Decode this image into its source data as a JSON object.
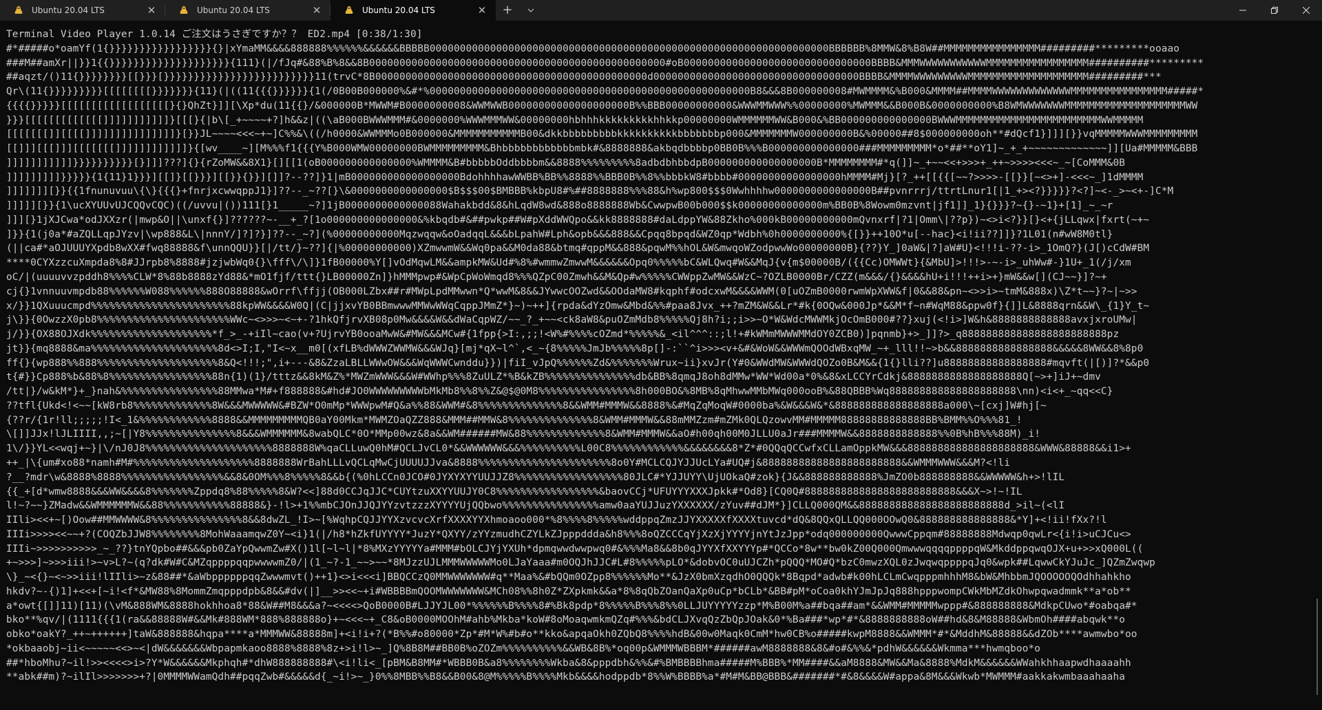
{
  "titlebar": {
    "tabs": [
      {
        "label": "Ubuntu 20.04 LTS",
        "active": false
      },
      {
        "label": "Ubuntu 20.04 LTS",
        "active": false
      },
      {
        "label": "Ubuntu 20.04 LTS",
        "active": true
      }
    ],
    "close_glyph": "✕",
    "new_tab_glyph": "+",
    "dropdown_glyph": "⌄",
    "window_controls": {
      "minimize": "—",
      "restore": "❐",
      "close": "✕"
    }
  },
  "colors": {
    "terminal_bg": "#0c0c0c",
    "terminal_fg": "#cccccc",
    "titlebar_bg": "#202020",
    "ubuntu_icon": "#e95420"
  },
  "icons": {
    "tab_icon": "penguin-icon"
  },
  "terminal": {
    "lines": [
      "Terminal Video Player 1.0.14 ご注文はうさぎですか？？ ED2.mp4 [0:38/1:30]",
      "#*#####o*oamYf(1{}}}}}}}}}}}}}}}}}{}|xYmaMM&&&&888888%%%%%%&&&&&&BBBBB000000000000000000000000000000000000000000000000000000000000000000BBBBBB%8MMW&8%B8W##MMMMMMMMMMMMMMMM#########*********ooaao",
      "###M##amXr||}}1{{}}}}}}}}}}}}}}}}}}}}{111}(|/fJq#&88%B%8&&8B0000000000000000000000000000000000000000000000000#oB0000000000000000000000000000000BBBB&MMMWWWWWWWWWWWMMMMMMMMMMMMMMMMM##########*********",
      "##aqzt/()11{}}}}}}}}[[}}}[}}}}}}}}}}}}}}}}}}}}}}}}}11(trvC*8B000000000000000000000000000000000000000000000d0000000000000000000000000000000000BBBB&MMMMWWWWWWWWWMMMMMMMMMMMMMMMMMMMM#########***",
      "Qr\\(11{}}}}}}}}}[[[[[[[[}}}}}}}{11}(|((11{{{}}}}}}{1(/0B00B000000%&#*%00000000000000000000000000000000000000000000000000000B8&&&8B000000008#MWMMMM&%B000&MMMM##MMMMWWWWWWWWWWWWWMMMMMMMMMMMMMMMM#####*",
      "{{{{}}}}}[[[[[[[[[[[[[[[[[[}{}QhZt}]][\\Xp*du(11{{}/&000000B*MWWM#B0000000008&WWMWWB00000000000000000000B%%BBB00000000000&WWWMMWWW%%00000000%MWMMM&&B000B&0000000000%B8WMWWWWWWWMMMMMMMMMMMMMMMMMMMMWW",
      "}}}[[[[[[[[[[[[[]]]]]]]]]]]}[[[}{|b\\[_+~~~~+?]h&&z|((\\aB000BWWWMMM#&0000000%WWWMMMWW&00000000hbhhhkkkkkkkkkhhkkp00000000WMMMMMMWW&B000&%BB000000000000000BWWWMMMMMMMMMMMMMMMMMMMMMMMMWWMMMMM",
      "[[[[[[[]][[[[]]]]]]]]]]]]]]]}[}}JL~~~~<<<~+~]C%%&\\((/h0000&WWMMMo0B000000&MMMMMMMMMMMB00&dkkbbbbbbbbbkkkkkkkkkkbbbbbbbp000&MMMMMMMW000000000B&%00000##8$000000000oh**#dQcf1}]]][}}vqMMMMMWWWMMMMMMMMM",
      "[[]]][[[]]][[[[[[[]]]]]]]]]]]]}{[wv____~][M%%%f1{{{Y%B000WMW00000000BWMMMMMMMMM&Bhbbbbbbbbbbbbmbk#&8888888&akbqdbbbbp0BB0B%%%B000000000000000###MMMMMMMMM*o*##**oY1]~_+_+~~~~~~~~~~~~~]][Ua#MMMMM&BBB",
      "]]]]]]]]]]]}}}}}}}}}}[}]]]???]{}{rZoMW&&8X1}[][[1(oB000000000000000%WMMMM&B#bbbbbOddbbbbm&&8888%%%%%%%%%8adbdbhbbdpB000000000000000000B*MMMMMMMM#*q(]]~_+~~<<+>>>+_++~>>>><<<~_~[CoMMM&0B",
      "]]]]]]]]]}}}}}{1{11}1}}}][[]}[[}}}][[}}{}}][]]?--??]}1|mB000000000000000000BdohhhhawWWBB%BB%%8888%%BBB0B%%8%%bbbkW8#bbbb#00000000000000000hMMMM#Mj}[?_++[[{{[~~?>>>>-[[}}[~<>+]-<<<~_]1dMMMM",
      "]]]]]]][}}{{1fnunuvuu\\{\\}{{{}+fnrjxcwwqppJ1}]??--_~??[}\\&0000000000000000$B$$$00$BMBBB%kbpU8#%##8888888%%%88&h%wp800$$$0Wwhhhhw0000000000000000B##pvnrrrj/ttrtLnur1[|1_+><?}}}}}?<?]~<-_>~<+-]C*M",
      "]]]]][}}{1\\ucXYUUvUJCQQvCQC)((/uvvu|())111[}1_____~?]1jB0000000000000088Wahakbdd&8&hLqdW8wd&888o8888888Wb&CwwpwB00b000$$k00000000000000m%BB0B%8Wowm0mzvnt|jf1]]_1}{}}}?~{}-~1}+[1]_~_~r",
      "]]][}1jXJCwa*odJXXzr(|mwp&O||\\unxf{}]??????~-__+_?[1o000000000000000&%kbqdb#&##pwkp##W#pXddWWQpo&&kk8888888#daLdppYW&88Zkho%000kB00000000000mQvnxrf|?1|Omm\\|??p})~<>i<?}}[}<+{jLLqwx|fxrt(~+~",
      "]}}{1(j0a*#aZQLLqpJYzv|\\wp888&L\\|nnnY/]?]?}]??--_~?](%00000000000Mqzwqqw&oOadqqL&&&bLpahW#Lph&opb&&&888&&Cpqq8bpqd&WZ0qp*Wdbh%0h0000000000%{[}}++10O*u[--hac}<i!ii??]]}?1L01(n#wW8M0tl}",
      "(||ca#*aOJUUUYXpdb8wXX#fwq88888&f\\unnQQU}}[|/tt/}~??]{|%00000000000)XZmwwmW&&Wq0pa&&M0da88&btmq#qppM&&888&pqwM%%hOL&W&mwqoWZodpwwWo00000000B}{??}Y_]0aW&|?]aW#U}<!!!i-??-i>_1OmQ?}(J[)cCdW#BM",
      "****0CYXzzcuXmpda8%8#JJrpb8%8888#jzjwbWq0{}\\fff\\/\\]}1fB00000%Y[]vOdMqwLM&&ampkMW&Ud#%8%#wmmwZmwwM&&&&&&Opq0%%%%%bC&WLQwq#W&&MqJ{v{m$00000B/({{Cc)OMWWt}{&MbU]>!!!>-~-i>_uhWw#-}1U+_1(/j/xm",
      "oC/|(uuuuvvzpddh8%%%%CLW*8%88b8888zYd88&*mO1fjf/ttt{}LB00000Zn]}hMMMpwp#&WpCpWoWmqd8%%%QZpC00Zmwh&&M&Qp#w%%%%%CWWppZwMW&&WzC~?OZLB0000Br/CZZ(m&&&/{}&&&&hU+i!!!++i>+}mW&&w[](CJ~~}]?~+",
      "cj{}1vnnuuvmpdb88%%%%%%W088%%%%%%888O88888&wOrrf\\ffjj(OB000LZbx##r#MWpLpdMMwwn*Q*wwM&8&&JYwwcOOZwd&&OOdaMW8#kqphf#odcxwM&&&&WWM(0[uOZmB0000rwmWpXWW&f|0&&88&pn~<>>i>~tmM&888x)\\Z*t~~}?~|~>>",
      "x/}}1QXuuucmpd%%%%%%%%%%%%%%%%%%%%%%%88kpWW&&&&W0Q|(C|jjxvYB0BBmwwwMMWwWWqCqppJMmZ*}~)~++]{rpda&dYzOmw&Mbd&%%#paa8Jvx_++?mZM&W&&Lr*#k{0OQw&000Jp*&&M*f~n#WqM88&ppw0f}{]]L&8888qrn&&W\\_{1}Y_t~",
      "j\\}}{0OwzzX0pb8%%%%%%%%%%%%%%%%%%%%%%WWc~<>>>~<~+-?1hkQfjrvXB08p0Mw&&&&W&&dWaCqpWZ/~~_?_+~~<ck8aW8&puOZmMdb8%%%%%Qj8h?i;;i>>~O*W&WdcMWWMkjOcOmB000#??}xuj(<!i>]W&h&8888888888888avxjxroUMw|",
      "j/}}{OX88OJXdk%%%%%%%%%%%%%%%%%%%%*f_>_-+iIl~cao(v+?UjrvYB0ooaMwW&#MW&&&MCw#{1fpp{>I:,;;!<W%#%%%%cOZmd*%%%%%&_<il^^^::;l!+#kWMmMWWWMMdOY0ZCB0)]pqnmb}+>_]]?>_q888888888888888888888888pz",
      "jt}}{mq8888&ma%%%%%%%%%%%%%%%%%%%%%8d<>I;I,\"I<~x__m0[(xfLB%dWWWZWWMW&&&WJq}[mj*qX~l^`,<_~{8%%%%%JmJb%%%%%8p[]-:``^i>>><v+&#&WoW&&WWWmQOOdWBxqMW_~+_lll!!~>b&&8888888888888888&&&&&8WW&&8%8p0",
      "ff{}{wp888%%888%%%%%%%%%%%%%%%%%%%%8&Q<!!!;\",i+---&8&ZzaLBLLWWwOW&&&WqWWWCwnddu}})|fiI_vJpQ%%%%%%Zd&%%%%%%%Wrux~ii}xvJr(Y#0&WWdMW&WWWdQOZo0B&M&&{1{}lli??]u88888888888888888#mqvft(|[)]?*&&p0",
      "t{#}}Cp888%b&88%8%%%%%%%%%%%%%%%%%88n{1)(1}/tttz&&8kM&Z%*MWZmWWW&&&W#WWhp%%%8ZuULZ*%B&kZB%%%%%%%%%%%%%%%db&BB%8qmqJ8oh8dMMw*WW*Wd00a*0%&8&xLCCYrCdkj&8888888888888888888Q[~>+]iJ+~dmv",
      "/tt|}/w&kM*}+_}nah&%%%%%%%%%%%%%%%%88MMwa*M#+f888888&#hd#JO0WWWWWWWWWbMkMb8%%8%%Z&@$@0M8%%%%%%%%%%%%%%%%8h000BO&%8MB%8qMhwwMMbMWq000ooB%&88QBBB%Wq888888888888888888888\\nn)<i<+_~qq<<C}",
      "??tfl{Ukd<!<~~[kW8rb8%%%%%%%%%%%%%8W&&&MWWWWW&#BZW*O0mMp*WWWpwM#Q&a%%88&WWM#&8%%%%%%%%%%%%%%8&&WMM#MMMW&&8888%&#MqZqMoqW#0000ba%&W&&&W&*&888888888888888888a000\\~[cxj]W#hj[~",
      "{??r/{1r!ll;;;;;!I<_1&%%%%%%%%%%%%8888&&MMMMMMMMMQB0aY00Mkm*MWMZOaQZZ888&MMM##MMW&8%%%%%%%%%%%%%%8&WMM#MMMW&&88mMMZzm#mZMk0QLQzowvMM#MMMMM88888888888888BB%BMM%%O%%%81_!",
      "\\[]]JJx!lJLIIII,,;~[|Y8%%%%%%%%%%%%%%%8&&&WMMMMMM&8wabQLC*0O*MMp00wz&8a&&WM######MW&88%%%%%%%%%%%%%8&WMM#MMMW&&aO#h00qh00M0JLLU0aJr###MMMMW&&8888888888888%%0B%hB%%%88M)_i!",
      "1\\/}}YL<<wqj+~}|\\/nJ0J8%%%%%%%%%%%%%%%%%%%%%8888888W%qaCLLuwQ0hM#QCLJvCL0*&&WWWWWW&&&%%%%%%%%%%L00C8%%%%%%%%%%%%&&&&&&&&8*Z*#0QQqQCCwfxCLLamOppkMW&&&888888888888888888888&WWW&88888&&i1>+",
      "++_|\\{um#xo88*namh#M#%%%%%%%%%%%%%%%%%%%%8888888WrBahLLLvQCLqMwCjUUUUJJva&8888%%%%%%%%%%%%%%%%%%%%%%8o0Y#MCLCQJYJJUcLYa#UQ#j&88888888888888888888888&&WMMMWWW&&&M?<!li",
      "?__?mdr\\w&8888%8888%%%%%%%%%%%%%%%%%&&8&0OM%%%8%%%%%8&&b{(%0hLCCn0JCO#0JYXYXYYUUJJZ8%%%%%%%%%%%%%%%%%%80JLC#*YJJUYY\\UjUOkaQ#zok}{J&&888888888888%JmZO0b888888888&&WWWWW&h+>!lIL",
      "{{_+[d*wmw8888&&&WW&&&&8%%%%%%%Zppdq8%88%%%%%8&W?<<]88d0CCJqJJC*CUYtzuXXYYUUJY0C8%%%%%%%%%%%%%%%%%&baovCCj*UFUYYYXXXJpkk#*Od8}[CQ0Q#8888888888888888888888888&&&X~>!~!IL",
      "l!~?~~}ZMadw&&WMMMMMMW&&88%%%%%%%%%%%88888&}-!l>+1%%mbCJOnJJQJYYzvtzzzXYYYYUjQQbwo%%%%%%%%%%%%%%%%amw0aaYUJJuzYXXXXXX/zYuv##dJM*}]CLLQ000QM&&888888888888888888888888d_>il~(<lI",
      "IIli><<+~[)Oow##MMWWWW&8%%%%%%%%%%%%%%%8&&8dwZL_!I>~[%WqhpCQJJYYXzvcvcXrfXXXXYYXhmoaoo000*%8%%%%8%%%%%wddppqZmzJJYXXXXXfXXXXtuvcd*dQ&8QQxQLLQQ000OOwQ0&888888888888888&*Y]+<!ii!fXx?!l",
      "IIIi>>>><<~~+?(COQZbJJW8%%%%%%%%8MohWaaamqwZ0Y~<i}1(|/h8*hZkfUYYYY*JuzY*QXYY/zYYzmudhCZYLkZJpppddda&h8%%%8oQZCCCqYjXzXjYYYYjnYtJzJpp*odq000000000QwwwCppqm#88888888Mdwqp0qwLr<{i!i>uCJCu<>",
      "IIIi~>>>>>>>>>>_~_??}tnYQpbo##&&&pb0ZaYpQwwmZw#X()1l[~l~l|*8%MXzYYYYYa#MMM#bOLCJYjYXUh*dpmqwwdwwpwq0#&%%%Ma8&&8b0qJYYXfXXYYYp#*QCCo*8w**bw0kZ00Q000QmwwwqqqqppppqW&MkddppqwqOJX+u+>>xQ000L((",
      "+~>>>]~>>>iii!>~v>L?~(q?dk#W#C&MZqppppqqpwwwwmZ0/|(1_~?-1_~~>~~*8MJzzUJLMMMWWWWWMo0LJaYaaa#m0OQJhJJC#L#8%%%%%pLO*&dobvOC0uUJCZh*pQQQ*MO#Q*bzC0mwzXQL0zJwqwqppppqJq0&wpk##LqwwCkYJuJc_]QZmZwqwp",
      "\\}_~<{}~<~>>iii!lIIli>~z&88##*&aWbppppppqqZwwwmvt()++1}<>i<<<i]BBQCCzQ0MMWWWWWWW#q**Maa%&#bQQm0OZpp8%%%%%%Mo**&JzX0bmXzqdhO0QQQk*8Bqpd*adwb#k00hLCLmCwqpppmhhhM8&bW&MhbbmJQOOOOOQOdhhahkho",
      "hkdv?~-{)1]+<<+[~i!<f*&MW88%8MommZmqpppdpb&8&&#dv(|]__>><<~+i#WBBBBmQOOMWWWWWWW&MCh08%%8h0Z*ZXpkmk&&a*8%8qQbZOanQaXp0uCp*bCLb*&BB#pM*oCoa0khYJmJpJq888hpppwompCWkMbMZdkOhwpqwadmmk**a*ob**",
      "a*owt{[]]11)[11)(\\vM&888WM&8888hokhhoa8*88&W##M8&&&a?~<<<<>QoB0000B#LJJYJL00*%%%%%%B%%%%8#%Bk8pdp*8%%%%%B%%%8%%0LLJUYYYYYzzp*M%B00M%a##bqa##am*&&WMM#MMMMMwppp#&888888888&MdkpCUwo*#oabqa#*",
      "bko**%qv/|(1111{{{1(ra&&88888W#&&Mk#888WM*888%888888o}+~<<<~+_C8&oB0000MOOhM#ahb%Mkba*koW#8oMoaqwmkmQZq#%%%&bdCLJXvqQzZbQpJOak&0*%Ba###*wp*#*&8888888888oW##hd&8&M88888&WbmOh####abqwk**o",
      "obko*oakY?_++~++++++]taW&888888&hqpa****a*MMMWW&88888m]+<i!i+?(*B%%#o80000*Zp*#M*W%#b#o**kko&apqaOkh0ZQbQ8%%%%hdB&00w0Maqk0CmM*hw0CB%o#####kwpM8888&&WMMM*#*&MddhM&88888&&dZOb****awmwbo*oo",
      "*okbaaobj~ii<~~~~~<<>~<|dW&&&&&&&Wbpapmkaoo8888%8888%8z+>i!l>~_]Q%8B8M##BB0B%oZOZm%%%%%%%%%%&&WB&8B%*oq00p&WMMMWBBBM*######awM8888888&8&#o#&%%&*pdhW&&&&&&Wkmma***hwmqboo*o",
      "##*hboMhu?~il!>><<<<>i>?Y*W&&&&&&Mkphqh#*dhW888888888#\\<i!li<_[pBM&B8MM#*WBBB0B&a8%%%%%%%%Wkba&8&pppdbh&%%&#%BMBBBBhma#####M%BBB%*MM####&&aM8888&MW&&Ma&8888%MdkM&&&&&&WWahkhhaapwdhaaaahh",
      "**abk##m)?~ilIl>>>>>>>+?|0MMMMWWamQdh##pqqZwb#&&&&&d{_~i!>~_}0%%8MBB%%B8&&B00&8@M%%%%%B%%%%Mkb&&&&hodppdb*8%%W%BBBB%a*#M#M&BB@BBB&#######*#&8&&&&W#appa&8M&&&Wkwb*MWMMM#aakkakwmbaaahaaha"
    ]
  }
}
